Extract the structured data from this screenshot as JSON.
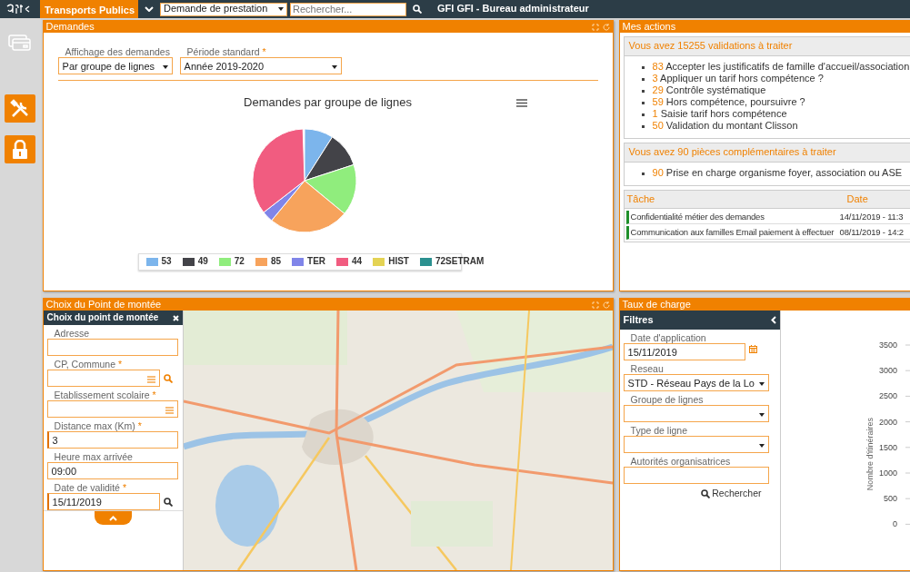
{
  "top_bar": {
    "app": "Transports Publics",
    "module_select": "Demande de prestation",
    "search": {
      "placeholder": "Rechercher..."
    },
    "user": "GFI GFI - Bureau administrateur"
  },
  "demandes": {
    "title": "Demandes",
    "filters": [
      {
        "label": "Affichage des demandes",
        "value": "Par groupe de lignes"
      },
      {
        "label": "Période standard",
        "required_mark": "*",
        "value": "Année 2019-2020"
      }
    ],
    "chart": {
      "title": "Demandes par groupe de lignes",
      "legend": [
        {
          "label": "53",
          "color": "#7cb5ec"
        },
        {
          "label": "49",
          "color": "#434348"
        },
        {
          "label": "72",
          "color": "#90ed7d"
        },
        {
          "label": "85",
          "color": "#f7a35c"
        },
        {
          "label": "TER",
          "color": "#8085e9"
        },
        {
          "label": "44",
          "color": "#f15c80"
        },
        {
          "label": "HIST",
          "color": "#e4d354"
        },
        {
          "label": "72SETRAM",
          "color": "#2b908f"
        }
      ]
    }
  },
  "mes_actions": {
    "title": "Mes actions",
    "sections": [
      {
        "heading": "Vous avez 15255 validations à traiter",
        "items": [
          {
            "count": "83",
            "text": "Accepter les justificatifs de famille d'accueil/association"
          },
          {
            "count": "3",
            "text": "Appliquer un tarif hors compétence ?"
          },
          {
            "count": "29",
            "text": "Contrôle systématique"
          },
          {
            "count": "59",
            "text": "Hors compétence, poursuivre ?"
          },
          {
            "count": "1",
            "text": "Saisie tarif hors compétence"
          },
          {
            "count": "50",
            "text": "Validation du montant Clisson"
          }
        ]
      },
      {
        "heading": "Vous avez 90 pièces complémentaires à traiter",
        "items": [
          {
            "count": "90",
            "text": "Prise en charge organisme foyer, association ou ASE"
          }
        ]
      }
    ],
    "tasks": {
      "columns": [
        "Tâche",
        "Date"
      ],
      "rows": [
        {
          "task": "Confidentialité métier des demandes",
          "date": "14/11/2019 - 11:3"
        },
        {
          "task": "Communication aux familles Email paiement à effectuer",
          "date": "08/11/2019 - 14:2"
        }
      ]
    }
  },
  "choix": {
    "title": "Choix du Point de montée",
    "panel_title": "Choix du point de montée",
    "fields": [
      {
        "label": "Adresse",
        "kind": "text"
      },
      {
        "label": "CP, Commune",
        "required_mark": "*",
        "kind": "list",
        "search_button": true,
        "search_accent": true
      },
      {
        "label": "Etablissement scolaire",
        "required_mark": "*",
        "kind": "list"
      },
      {
        "label": "Distance max (Km)",
        "required_mark": "*",
        "kind": "text",
        "value": "3"
      },
      {
        "label": "Heure max arrivée",
        "kind": "text",
        "value": "09:00"
      },
      {
        "label": "Date de validité",
        "required_mark": "*",
        "kind": "text",
        "value": "15/11/2019",
        "search_button": true,
        "search_accent": false
      }
    ]
  },
  "taux": {
    "title": "Taux de charge",
    "filters_title": "Filtres",
    "fields": [
      {
        "label": "Date d'application",
        "kind": "date",
        "value": "15/11/2019"
      },
      {
        "label": "Reseau",
        "kind": "select",
        "value": "STD - Réseau Pays de la Lo"
      },
      {
        "label": "Groupe de lignes",
        "kind": "select"
      },
      {
        "label": "Type de ligne",
        "kind": "select"
      },
      {
        "label": "Autorités organisatrices",
        "kind": "text"
      }
    ],
    "search_button": "Rechercher",
    "chart": {
      "ylabel": "Nombre d'itinéraires",
      "yticks": [
        "3500",
        "3000",
        "2500",
        "2000",
        "1500",
        "1000",
        "500",
        "0"
      ]
    }
  }
}
